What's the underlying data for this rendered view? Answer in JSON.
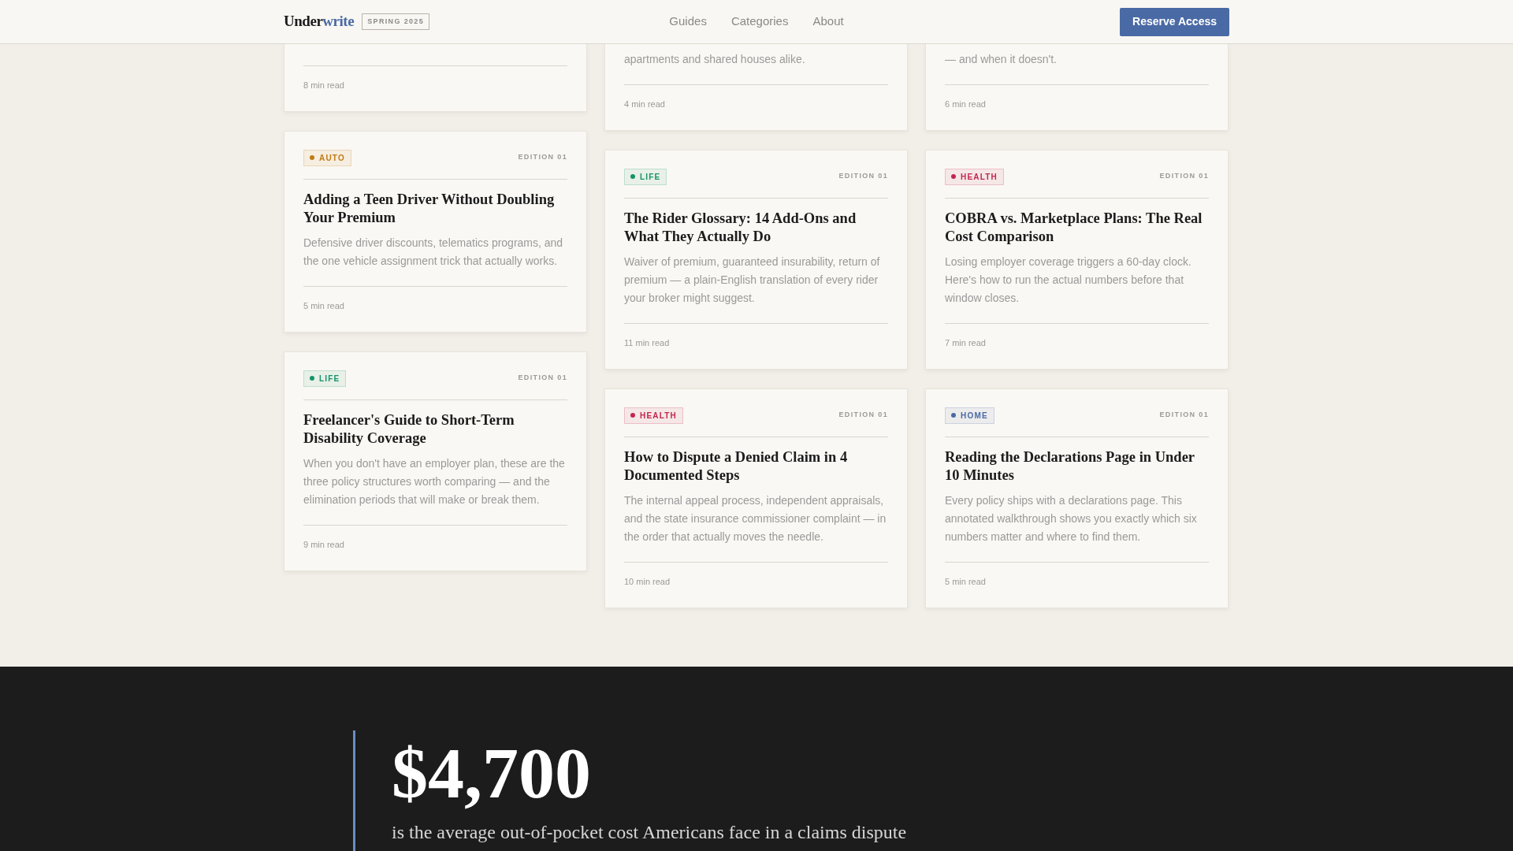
{
  "header": {
    "logo": {
      "first": "Under",
      "second": "write"
    },
    "season_badge": "SPRING 2025",
    "nav": [
      "Guides",
      "Categories",
      "About"
    ],
    "cta": "Reserve Access"
  },
  "columns": [
    {
      "cards": [
        {
          "read_time": "8 min read"
        },
        {
          "category": {
            "label": "AUTO",
            "color": "#c27a12"
          },
          "edition": "EDITION 01",
          "title": "Adding a Teen Driver Without Doubling Your Premium",
          "description": "Defensive driver discounts, telematics programs, and the one vehicle assignment trick that actually works.",
          "read_time": "5 min read"
        },
        {
          "category": {
            "label": "LIFE",
            "color": "#14946a"
          },
          "edition": "EDITION 01",
          "title": "Freelancer's Guide to Short-Term Disability Coverage",
          "description": "When you don't have an employer plan, these are the three policy structures worth comparing — and the elimination periods that will make or break them.",
          "read_time": "9 min read"
        }
      ]
    },
    {
      "cards": [
        {
          "description": "apartments and shared houses alike.",
          "read_time": "4 min read"
        },
        {
          "category": {
            "label": "LIFE",
            "color": "#14946a"
          },
          "edition": "EDITION 01",
          "title": "The Rider Glossary: 14 Add-Ons and What They Actually Do",
          "description": "Waiver of premium, guaranteed insurability, return of premium — a plain-English translation of every rider your broker might suggest.",
          "read_time": "11 min read"
        },
        {
          "category": {
            "label": "HEALTH",
            "color": "#c2264f"
          },
          "edition": "EDITION 01",
          "title": "How to Dispute a Denied Claim in 4 Documented Steps",
          "description": "The internal appeal process, independent appraisals, and the state insurance commissioner complaint — in the order that actually moves the needle.",
          "read_time": "10 min read"
        }
      ]
    },
    {
      "cards": [
        {
          "description": "— and when it doesn't.",
          "read_time": "6 min read"
        },
        {
          "category": {
            "label": "HEALTH",
            "color": "#c2264f"
          },
          "edition": "EDITION 01",
          "title": "COBRA vs. Marketplace Plans: The Real Cost Comparison",
          "description": "Losing employer coverage triggers a 60-day clock. Here's how to run the actual numbers before that window closes.",
          "read_time": "7 min read"
        },
        {
          "category": {
            "label": "HOME",
            "color": "#4a6aa5"
          },
          "edition": "EDITION 01",
          "title": "Reading the Declarations Page in Under 10 Minutes",
          "description": "Every policy ships with a declarations page. This annotated walkthrough shows you exactly which six numbers matter and where to find them.",
          "read_time": "5 min read"
        }
      ]
    }
  ],
  "stat": {
    "figure": "$4,700",
    "caption": "is the average out-of-pocket cost Americans face in a claims dispute"
  }
}
